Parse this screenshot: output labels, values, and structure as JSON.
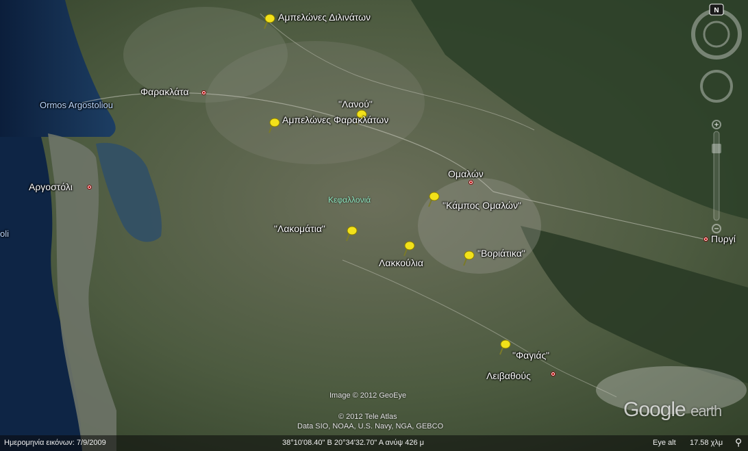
{
  "places": [
    {
      "id": "ampelones-dilinaton",
      "label": "Αμπελώνες Διλινάτων",
      "type": "pin"
    },
    {
      "id": "farakla",
      "label": "Φαρακλάτα",
      "type": "town"
    },
    {
      "id": "ormos",
      "label": "Ormos Argostoliou",
      "type": "water"
    },
    {
      "id": "lanou",
      "label": "\"Λανού\"",
      "type": "pin"
    },
    {
      "id": "ampelones-faraklaton",
      "label": "Αμπελώνες Φαρακλάτων",
      "type": "pin"
    },
    {
      "id": "argostoli",
      "label": "Αργοστόλι",
      "type": "town"
    },
    {
      "id": "omalon",
      "label": "Ομαλών",
      "type": "town"
    },
    {
      "id": "kefalonia",
      "label": "Κεφαλλονιά",
      "type": "region"
    },
    {
      "id": "kampos-omalon",
      "label": "\"Κάμπος Ομαλών\"",
      "type": "pin"
    },
    {
      "id": "lakomatia",
      "label": "\"Λακομάτια\"",
      "type": "pin"
    },
    {
      "id": "lakkoulia",
      "label": "Λακκούλια",
      "type": "pin"
    },
    {
      "id": "voriatika",
      "label": "\"Βοριάτικα\"",
      "type": "pin"
    },
    {
      "id": "pyrgi",
      "label": "Πυργί",
      "type": "town"
    },
    {
      "id": "oli",
      "label": "oli",
      "type": "water"
    },
    {
      "id": "fagias",
      "label": "\"Φαγιάς\"",
      "type": "pin"
    },
    {
      "id": "leivathous",
      "label": "Λειβαθούς",
      "type": "town"
    }
  ],
  "credits": {
    "geoeye": "Image © 2012 GeoEye",
    "teleatlas": "© 2012 Tele Atlas",
    "data": "Data SIO, NOAA, U.S. Navy, NGA, GEBCO"
  },
  "status": {
    "imagery_date": "Ημερομηνία εικόνων: 7/9/2009",
    "coordinates": "38°10'08.40\" Β  20°34'32.70\" Α  ανύψ   426 μ",
    "eye_alt_label": "Eye alt",
    "eye_alt_value": "17.58 χλμ"
  },
  "logo": {
    "google": "Google",
    "earth": "earth"
  },
  "compass": {
    "north": "N"
  },
  "colors": {
    "pin": "#f2e11a",
    "town_dot": "#c00000",
    "sea": "#0f2747",
    "land": "#4a5a3e"
  }
}
